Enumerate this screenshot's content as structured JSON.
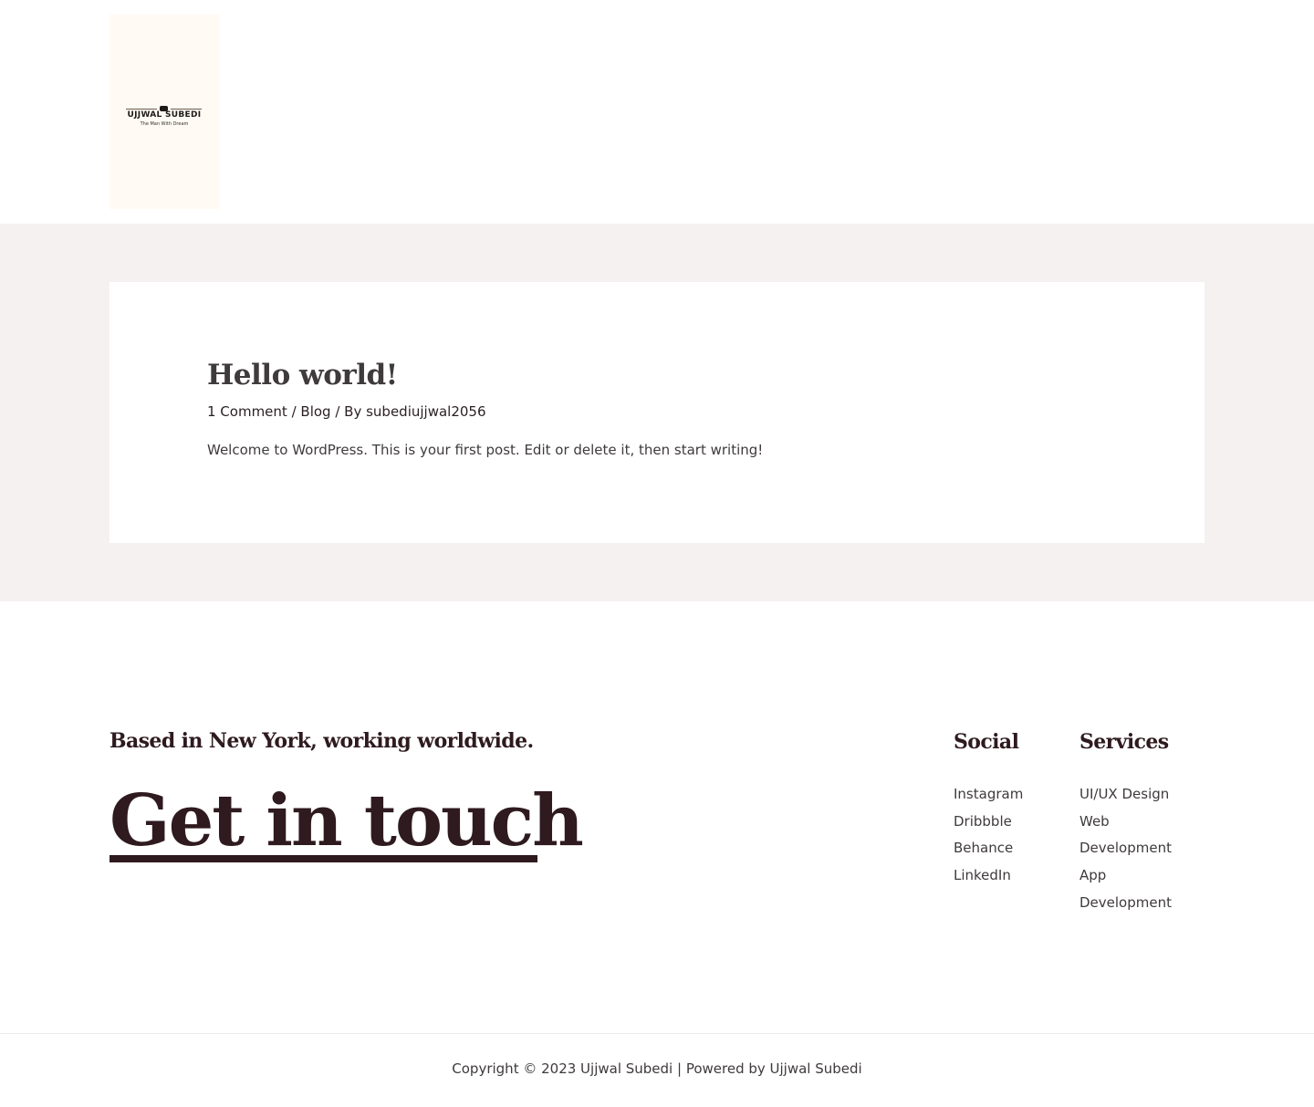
{
  "header": {
    "logo": {
      "name": "Ujjwal Subedi",
      "tagline": "The Man With Dream",
      "background": "#fffaf4"
    }
  },
  "post": {
    "title": "Hello world!",
    "comments": "1 Comment",
    "separator1": " / ",
    "category": "Blog",
    "separator2": " / By ",
    "author": "subediujjwal2056",
    "excerpt": "Welcome to WordPress. This is your first post. Edit or delete it, then start writing!"
  },
  "footer": {
    "tagline": "Based in New York, working worldwide.",
    "cta": "Get in touch",
    "social": {
      "heading": "Social",
      "items": [
        "Instagram",
        "Dribbble",
        "Behance",
        "LinkedIn"
      ]
    },
    "services": {
      "heading": "Services",
      "items": [
        "UI/UX Design",
        "Web",
        "Development",
        "App",
        "Development"
      ]
    },
    "copyright": "Copyright © 2023 Ujjwal Subedi | Powered by Ujjwal Subedi"
  },
  "colors": {
    "band_background": "#f5f1f1",
    "card_background": "#ffffff",
    "heading": "#2e1a1f",
    "body_text": "#3f3a3b"
  }
}
